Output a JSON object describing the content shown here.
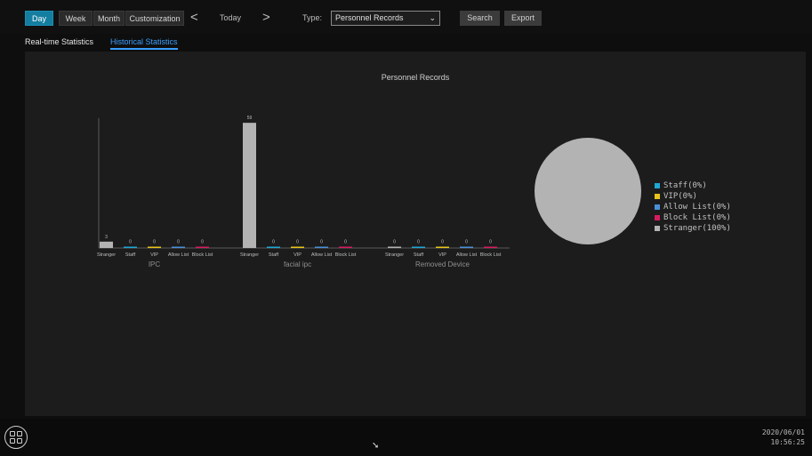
{
  "toolbar": {
    "periods": [
      "Day",
      "Week",
      "Month",
      "Customization"
    ],
    "active_period": "Day",
    "prev_arrow": "<",
    "today_label": "Today",
    "next_arrow": ">",
    "type_label": "Type:",
    "type_value": "Personnel Records",
    "type_caret": "⌄",
    "search_label": "Search",
    "export_label": "Export"
  },
  "subtabs": {
    "realtime": "Real-time Statistics",
    "historical": "Historical Statistics",
    "active": "historical"
  },
  "colors": {
    "accent": "#147ea0",
    "link": "#3aa0ff",
    "Staff": "#1fa7d6",
    "VIP": "#e8c41b",
    "Allow List": "#4a90d9",
    "Block List": "#d81b60",
    "Stranger": "#b3b3b3"
  },
  "chart_data": [
    {
      "type": "bar",
      "title": "Personnel Records",
      "categories": [
        "Stranger",
        "Staff",
        "VIP",
        "Allow List",
        "Block List"
      ],
      "category_labels": [
        "Stranger",
        "Staff",
        "VIP",
        "Allow List",
        "Block List"
      ],
      "groups": [
        {
          "name": "IPC",
          "values": [
            3,
            0,
            0,
            0,
            0
          ]
        },
        {
          "name": "facial ipc",
          "values": [
            59,
            0,
            0,
            0,
            0
          ]
        },
        {
          "name": "Removed Device",
          "values": [
            0,
            0,
            0,
            0,
            0
          ]
        }
      ],
      "ylim": [
        0,
        62
      ],
      "grid": false
    },
    {
      "type": "pie",
      "slices": [
        {
          "label": "Staff(0%)",
          "value": 0,
          "color": "#1fa7d6"
        },
        {
          "label": "VIP(0%)",
          "value": 0,
          "color": "#e8c41b"
        },
        {
          "label": "Allow List(0%)",
          "value": 0,
          "color": "#4a90d9"
        },
        {
          "label": "Block List(0%)",
          "value": 0,
          "color": "#d81b60"
        },
        {
          "label": "Stranger(100%)",
          "value": 100,
          "color": "#b3b3b3"
        }
      ],
      "legend_position": "right"
    }
  ],
  "status": {
    "date": "2020/06/01",
    "time": "10:56:25"
  }
}
